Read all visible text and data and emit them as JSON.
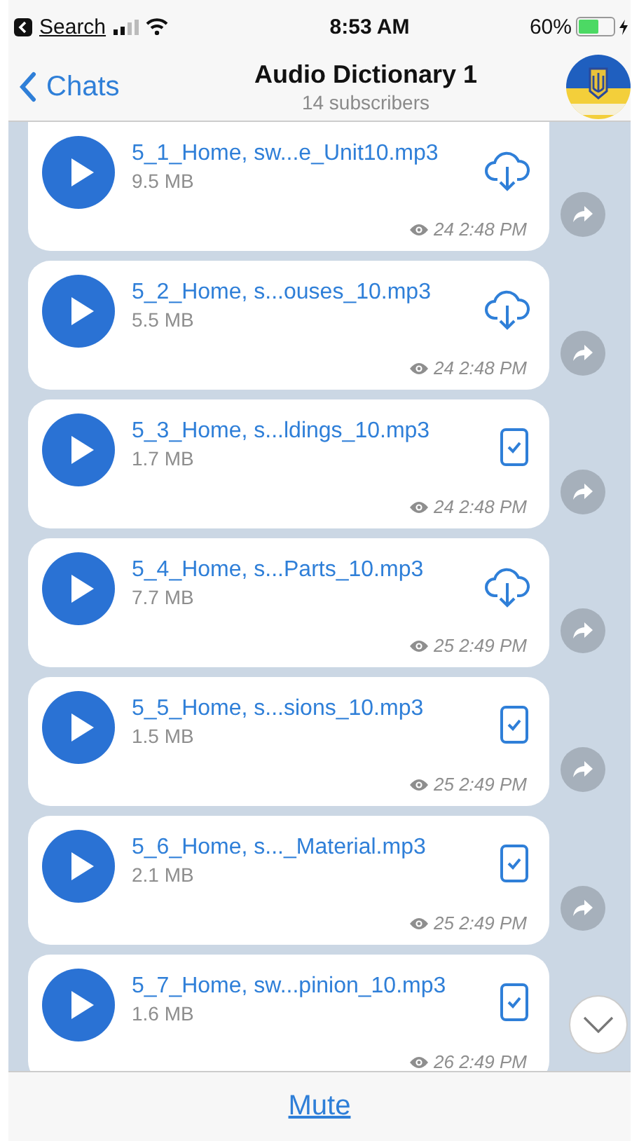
{
  "status_bar": {
    "back_app": "Search",
    "time": "8:53 AM",
    "battery": {
      "text": "60%",
      "level": 0.6
    }
  },
  "header": {
    "back": "Chats",
    "title": "Audio Dictionary 1",
    "subtitle": "14 subscribers"
  },
  "messages": [
    {
      "file": "5_1_Home, sw...e_Unit10.mp3",
      "size": "9.5 MB",
      "views": "24",
      "time": "2:48 PM",
      "downloaded": false,
      "share_button": true
    },
    {
      "file": "5_2_Home, s...ouses_10.mp3",
      "size": "5.5 MB",
      "views": "24",
      "time": "2:48 PM",
      "downloaded": false,
      "share_button": true
    },
    {
      "file": "5_3_Home, s...ldings_10.mp3",
      "size": "1.7 MB",
      "views": "24",
      "time": "2:48 PM",
      "downloaded": true,
      "share_button": true
    },
    {
      "file": "5_4_Home, s...Parts_10.mp3",
      "size": "7.7 MB",
      "views": "25",
      "time": "2:49 PM",
      "downloaded": false,
      "share_button": true
    },
    {
      "file": "5_5_Home, s...sions_10.mp3",
      "size": "1.5 MB",
      "views": "25",
      "time": "2:49 PM",
      "downloaded": true,
      "share_button": true
    },
    {
      "file": "5_6_Home, s..._Material.mp3",
      "size": "2.1 MB",
      "views": "25",
      "time": "2:49 PM",
      "downloaded": true,
      "share_button": true
    },
    {
      "file": "5_7_Home, sw...pinion_10.mp3",
      "size": "1.6 MB",
      "views": "26",
      "time": "2:49 PM",
      "downloaded": true,
      "share_button": false
    }
  ],
  "footer": {
    "button": "Mute"
  }
}
